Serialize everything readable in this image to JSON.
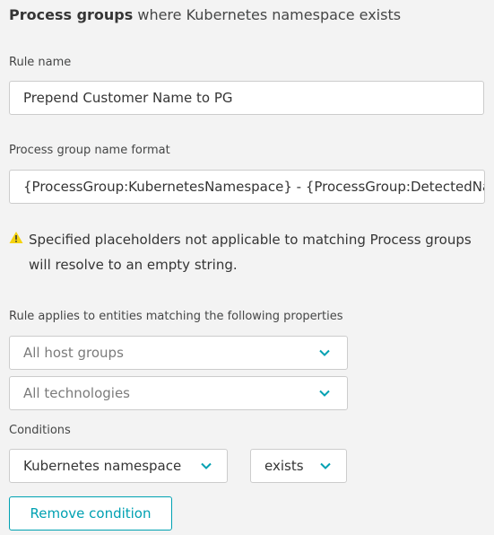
{
  "header": {
    "title_bold": "Process groups",
    "title_rest": " where Kubernetes namespace exists"
  },
  "rule_name": {
    "label": "Rule name",
    "value": "Prepend Customer Name to PG"
  },
  "name_format": {
    "label": "Process group name format",
    "value": "{ProcessGroup:KubernetesNamespace} - {ProcessGroup:DetectedName}"
  },
  "warning": {
    "icon": "warning-triangle-icon",
    "text": "Specified placeholders not applicable to matching Process groups will resolve to an empty string."
  },
  "applies": {
    "label": "Rule applies to entities matching the following properties",
    "host_groups": "All host groups",
    "technologies": "All technologies"
  },
  "conditions": {
    "label": "Conditions",
    "property": "Kubernetes namespace",
    "operator": "exists",
    "remove_label": "Remove condition"
  },
  "colors": {
    "accent": "#00a1b2",
    "warning": "#f5d30f",
    "background": "#f3f3f3"
  }
}
